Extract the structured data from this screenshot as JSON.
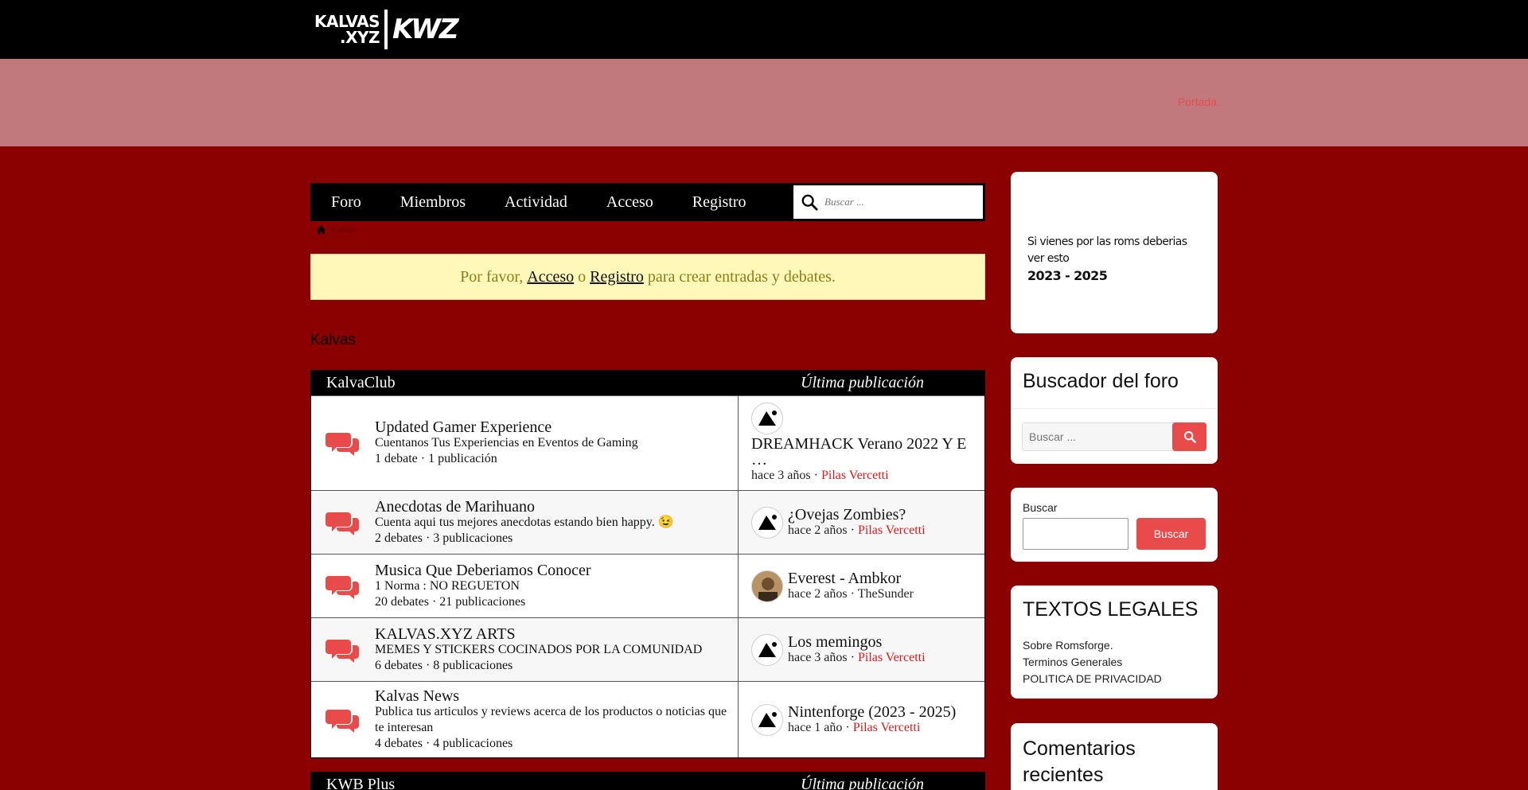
{
  "header": {
    "logo_line1": "KALVAS",
    "logo_line2": ".XYZ",
    "logo_mark": "KWZ",
    "portada_link": "Portada"
  },
  "nav": {
    "items": [
      "Foro",
      "Miembros",
      "Actividad",
      "Acceso",
      "Registro"
    ],
    "search_placeholder": "Buscar ..."
  },
  "breadcrumb": {
    "current": "Kalvas"
  },
  "notice": {
    "prefix": "Por favor,",
    "login": "Acceso",
    "or": "o",
    "register": "Registro",
    "suffix": "para crear entradas y debates."
  },
  "section_title": "Kalvas",
  "categories": [
    {
      "name": "KalvaClub",
      "last_header": "Última publicación",
      "forums": [
        {
          "title": "Updated Gamer Experience",
          "desc": "Cuentanos Tus Experiencias en Eventos de Gaming",
          "counts": "1 debate · 1 publicación",
          "last_title": "DREAMHACK Verano 2022 Y E …",
          "last_time": "hace 3 años ·",
          "last_author": "Pilas Vercetti"
        },
        {
          "title": "Anecdotas de Marihuano",
          "desc": "Cuenta aqui tus mejores anecdotas estando bien happy. 😉",
          "counts": "2 debates · 3 publicaciones",
          "last_title": "¿Ovejas Zombies?",
          "last_time": "hace 2 años ·",
          "last_author": "Pilas Vercetti"
        },
        {
          "title": "Musica Que Deberiamos Conocer",
          "desc": "1 Norma : NO REGUETON",
          "counts": "20 debates · 21 publicaciones",
          "last_title": "Everest - Ambkor",
          "last_time": "hace 2 años ·",
          "last_author": "TheSunder"
        },
        {
          "title": "KALVAS.XYZ ARTS",
          "desc": "MEMES Y STICKERS COCINADOS POR LA COMUNIDAD",
          "counts": "6 debates · 8 publicaciones",
          "last_title": "Los memingos",
          "last_time": "hace 3 años ·",
          "last_author": "Pilas Vercetti"
        },
        {
          "title": "Kalvas News",
          "desc": "Publica tus articulos y reviews acerca de los productos o noticias que te interesan",
          "counts": "4 debates · 4 publicaciones",
          "last_title": "Nintenforge (2023 - 2025)",
          "last_time": "hace 1 año ·",
          "last_author": "Pilas Vercetti"
        }
      ]
    },
    {
      "name": "KWB Plus",
      "last_header": "Última publicación"
    }
  ],
  "sidebar": {
    "promo_line1": "Si vienes por las roms deberias",
    "promo_line2": "ver esto",
    "promo_years": "2023 - 2025",
    "forum_search_title": "Buscador del foro",
    "forum_search_placeholder": "Buscar ...",
    "buscar_label": "Buscar",
    "buscar_button": "Buscar",
    "legal_title": "TEXTOS LEGALES",
    "legal_links": [
      "Sobre Romsforge.",
      "Terminos Generales",
      "POLITICA DE PRIVACIDAD"
    ],
    "comments_title": "Comentarios recientes"
  },
  "colors": {
    "background": "#8b0000",
    "band": "#c2797e",
    "accent": "#e94b4b",
    "author": "#e01818",
    "notice_bg": "#fff8b8"
  },
  "icons": [
    "search-icon",
    "home-icon",
    "forum-bubbles-icon",
    "avatar-icon"
  ]
}
